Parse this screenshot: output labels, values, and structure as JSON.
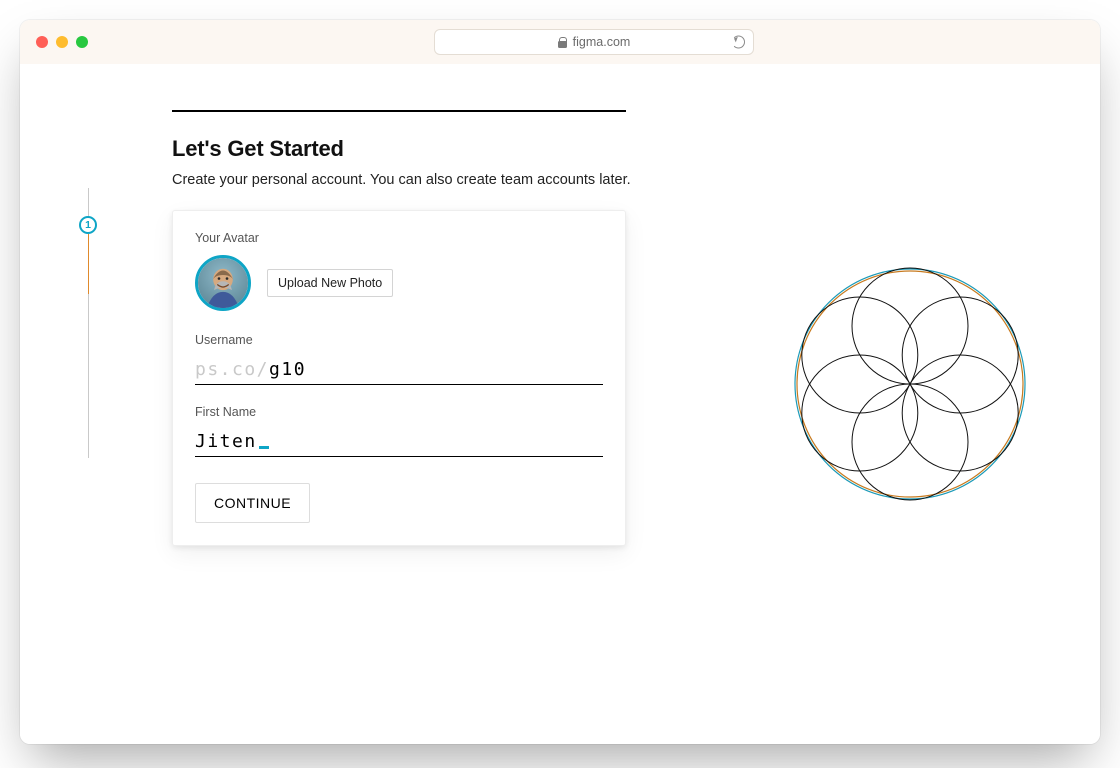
{
  "browser": {
    "url_host": "figma.com"
  },
  "page": {
    "title": "Let's Get Started",
    "subtitle": "Create your personal account. You can also create team accounts later."
  },
  "stepper": {
    "current": "1"
  },
  "form": {
    "avatar_label": "Your Avatar",
    "upload_label": "Upload New Photo",
    "username_label": "Username",
    "username_prefix": "ps.co/",
    "username_value": "g10",
    "firstname_label": "First Name",
    "firstname_value": "Jiten",
    "continue_label": "CONTINUE"
  }
}
